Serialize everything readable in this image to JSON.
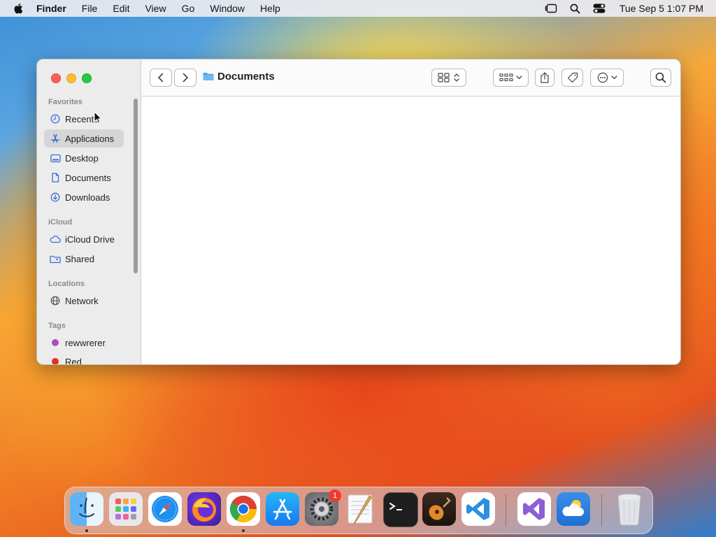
{
  "menubar": {
    "app_name": "Finder",
    "items": [
      "File",
      "Edit",
      "View",
      "Go",
      "Window",
      "Help"
    ],
    "clock": "Tue Sep 5  1:07 PM"
  },
  "window": {
    "title": "Documents"
  },
  "sidebar": {
    "sections": {
      "favorites": "Favorites",
      "icloud": "iCloud",
      "locations": "Locations",
      "tags": "Tags"
    },
    "favorites": [
      {
        "label": "Recents",
        "icon": "clock-icon"
      },
      {
        "label": "Applications",
        "icon": "applications-icon",
        "selected": true
      },
      {
        "label": "Desktop",
        "icon": "desktop-icon"
      },
      {
        "label": "Documents",
        "icon": "document-icon"
      },
      {
        "label": "Downloads",
        "icon": "downloads-icon"
      }
    ],
    "icloud": [
      {
        "label": "iCloud Drive",
        "icon": "cloud-icon"
      },
      {
        "label": "Shared",
        "icon": "shared-folder-icon"
      }
    ],
    "locations": [
      {
        "label": "Network",
        "icon": "globe-icon"
      }
    ],
    "tags": [
      {
        "label": "rewwrerer",
        "color": "#a64fc2"
      },
      {
        "label": "Red",
        "color": "#e2302a"
      }
    ]
  },
  "dock": {
    "apps": [
      "Finder",
      "Launchpad",
      "Safari",
      "Firefox",
      "Chrome",
      "App Store",
      "System Settings",
      "TextEdit",
      "Terminal",
      "GarageBand",
      "VS Code",
      "Visual Studio",
      "Weather",
      "Trash"
    ],
    "settings_badge": "1"
  }
}
